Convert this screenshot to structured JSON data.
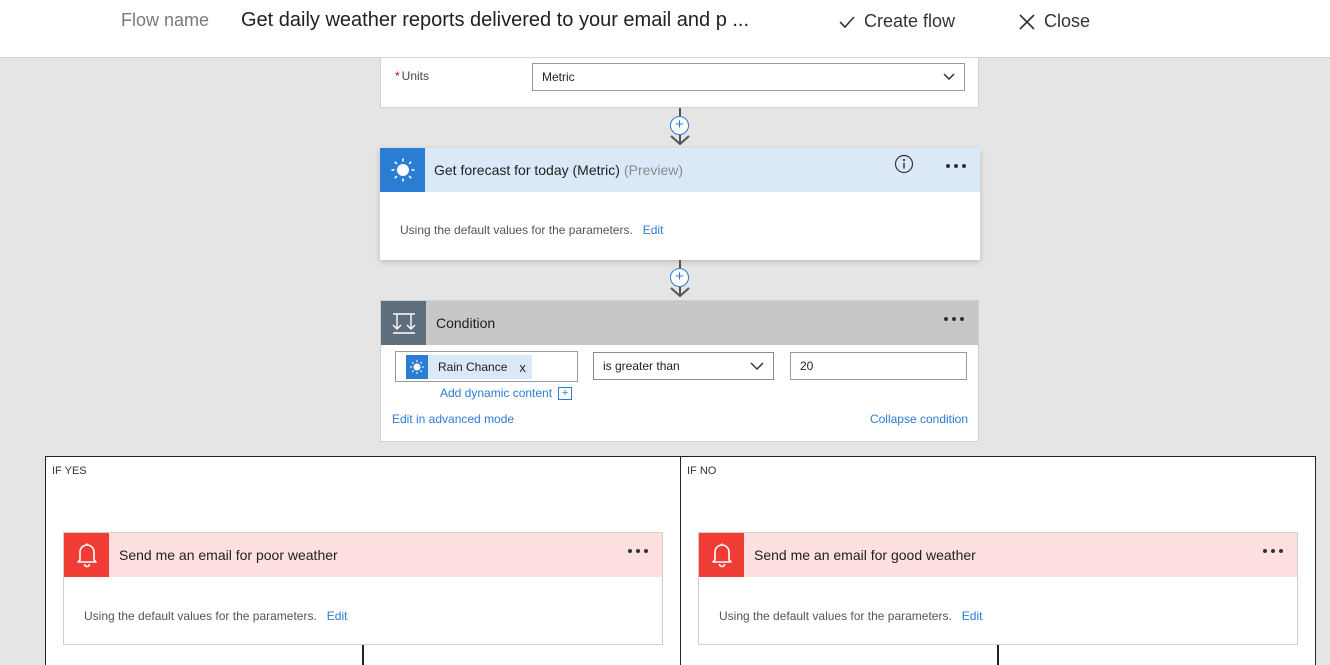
{
  "header": {
    "flow_name_label": "Flow name",
    "flow_name_value": "Get daily weather reports delivered to your email and p ...",
    "create_flow_label": "Create flow",
    "close_label": "Close"
  },
  "units": {
    "label": "Units",
    "required_mark": "*",
    "selected": "Metric"
  },
  "forecast": {
    "title": "Get forecast for today (Metric)",
    "badge": "(Preview)",
    "body_text": "Using the default values for the parameters.",
    "edit_label": "Edit",
    "header_color": "#dbe8f7",
    "icon_color": "#2b7cd3"
  },
  "condition": {
    "title": "Condition",
    "token_label": "Rain Chance",
    "token_remove": "x",
    "add_dynamic_label": "Add dynamic content",
    "add_dynamic_box": "+",
    "operator": "is greater than",
    "value": "20",
    "advanced_mode_label": "Edit in advanced mode",
    "collapse_label": "Collapse condition",
    "header_color": "#c7c7c7",
    "icon_color": "#5f6e7d"
  },
  "branches": {
    "yes": {
      "label": "IF YES",
      "card_title": "Send me an email for poor weather",
      "body_text": "Using the default values for the parameters.",
      "edit_label": "Edit"
    },
    "no": {
      "label": "IF NO",
      "card_title": "Send me an email for good weather",
      "body_text": "Using the default values for the parameters.",
      "edit_label": "Edit"
    },
    "card_header_color": "#fde0df",
    "icon_color": "#ef3d36"
  },
  "icons": {
    "create_flow": "checkmark-icon",
    "close": "close-icon",
    "forecast": "sun-icon",
    "condition": "condition-icon",
    "email": "bell-icon",
    "info": "info-icon",
    "more": "more-options-icon",
    "dropdown": "chevron-down-icon"
  }
}
